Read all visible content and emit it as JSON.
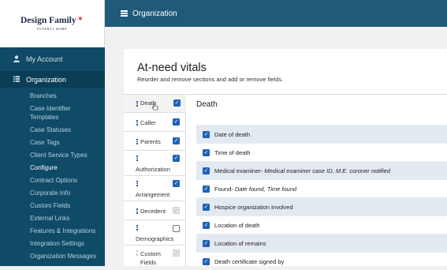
{
  "brand": {
    "name": "Design Family",
    "subtitle": "FUNERAL HOME"
  },
  "header": {
    "title": "Organization"
  },
  "sidebar": {
    "account_label": "My Account",
    "org_label": "Organization",
    "items": [
      {
        "label": "Branches"
      },
      {
        "label": "Case Identifier Templates"
      },
      {
        "label": "Case Statuses"
      },
      {
        "label": "Case Tags"
      },
      {
        "label": "Client Service Types"
      },
      {
        "label": "Configure"
      },
      {
        "label": "Contract Options"
      },
      {
        "label": "Corporate Info"
      },
      {
        "label": "Custom Fields"
      },
      {
        "label": "External Links"
      },
      {
        "label": "Features & Integrations"
      },
      {
        "label": "Integration Settings"
      },
      {
        "label": "Organization Messages"
      }
    ]
  },
  "main": {
    "title": "At-need vitals",
    "description": "Reorder and remove sections and add or remove fields.",
    "sections": [
      {
        "label": "Death",
        "checked": true
      },
      {
        "label": "Caller",
        "checked": true
      },
      {
        "label": "Parents",
        "checked": true
      },
      {
        "label": "Authorization",
        "checked": true
      },
      {
        "label": "Arrangement",
        "checked": true
      },
      {
        "label": "Decedent",
        "checked": true
      },
      {
        "label": "Demographics",
        "checked": false
      },
      {
        "label": "Custom Fields",
        "checked": true
      }
    ],
    "detail": {
      "title": "Death",
      "fields": [
        {
          "label": "Date of death",
          "subfields": ""
        },
        {
          "label": "Time of death",
          "subfields": ""
        },
        {
          "label": "Medical examiner",
          "subfields": " - Medical examiner case ID, M.E. coroner notified"
        },
        {
          "label": "Found",
          "subfields": " - Date found, Time found"
        },
        {
          "label": "Hospice organization involved",
          "subfields": ""
        },
        {
          "label": "Location of death",
          "subfields": ""
        },
        {
          "label": "Location of remains",
          "subfields": ""
        },
        {
          "label": "Death certificate signed by",
          "subfields": ""
        }
      ]
    }
  },
  "colors": {
    "sidebar_bg": "#0f4a66",
    "topbar_bg": "#1f5a78",
    "checkbox_blue": "#1f62b7",
    "row_shade": "#e3e9f0"
  }
}
